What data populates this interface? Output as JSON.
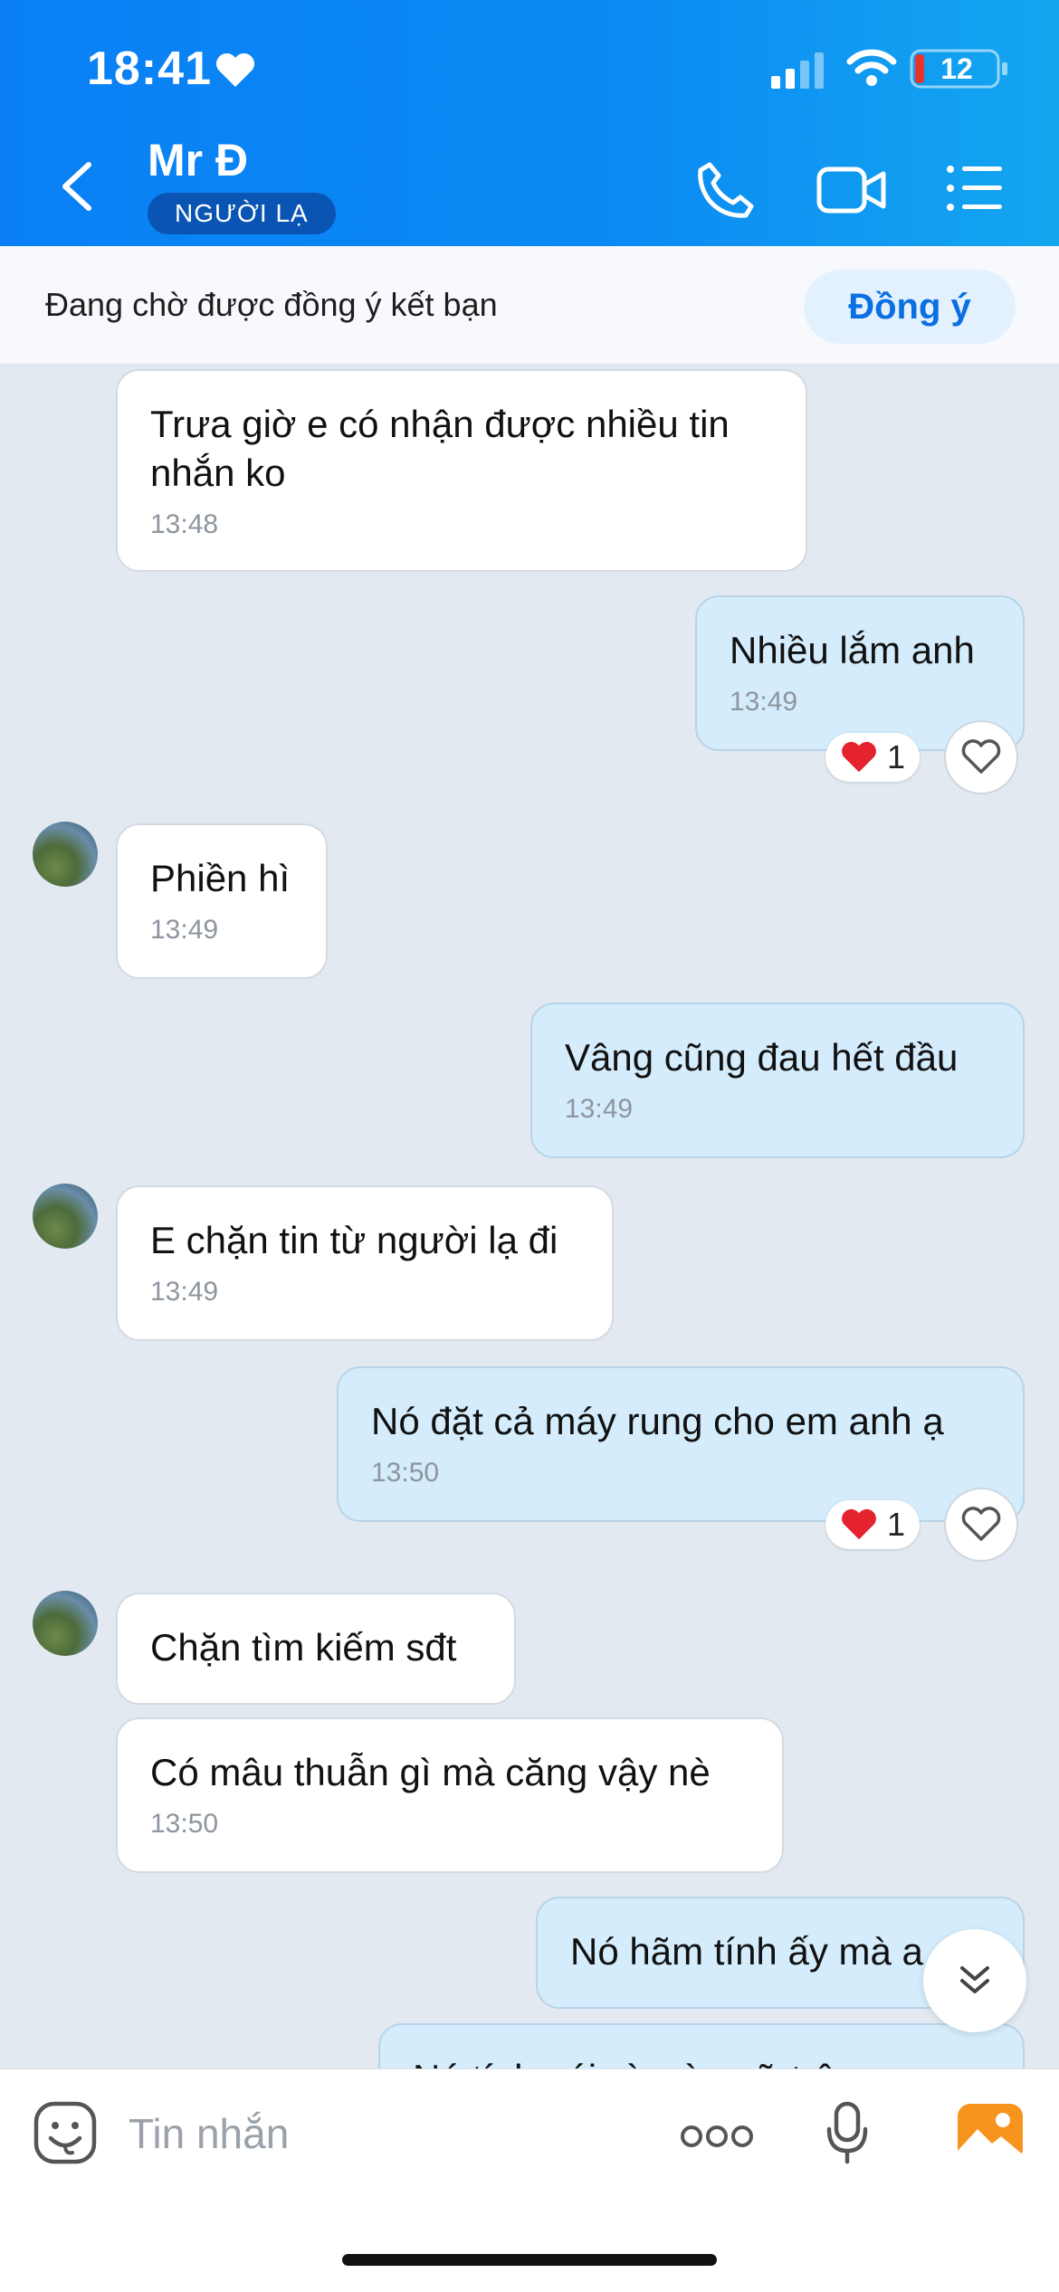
{
  "status_bar": {
    "time": "18:41",
    "battery": "12"
  },
  "header": {
    "contact_name": "Mr Đ",
    "badge": "NGƯỜI LẠ"
  },
  "friend_request": {
    "text": "Đang chờ được đồng ý kết bạn",
    "accept_label": "Đồng ý"
  },
  "messages": [
    {
      "dir": "in",
      "text": "Trưa giờ e có nhận được nhiều tin nhắn ko",
      "time": "13:48"
    },
    {
      "dir": "out",
      "text": "Nhiều lắm anh",
      "time": "13:49",
      "reaction_count": "1"
    },
    {
      "dir": "in",
      "text": "Phiền hì",
      "time": "13:49"
    },
    {
      "dir": "out",
      "text": "Vâng cũng đau hết đầu",
      "time": "13:49"
    },
    {
      "dir": "in",
      "text": "E chặn tin từ người lạ đi",
      "time": "13:49"
    },
    {
      "dir": "out",
      "text": "Nó đặt cả máy rung cho em anh ạ",
      "time": "13:50",
      "reaction_count": "1"
    },
    {
      "dir": "in",
      "text": "Chặn tìm kiếm sđt"
    },
    {
      "dir": "in",
      "text": "Có mâu thuẫn gì mà căng vậy nè",
      "time": "13:50"
    },
    {
      "dir": "out",
      "text": "Nó hãm tính ấy mà a"
    },
    {
      "dir": "out",
      "text": "Nó tính nói gì mà ngữ trêu"
    }
  ],
  "composer": {
    "placeholder": "Tin nhắn"
  },
  "colors": {
    "header": "#0a7ff5",
    "outgoing_bubble": "#d4ecfb",
    "incoming_bubble": "#ffffff",
    "chat_bg": "#e2e9f1",
    "accent": "#0a6fe0"
  }
}
